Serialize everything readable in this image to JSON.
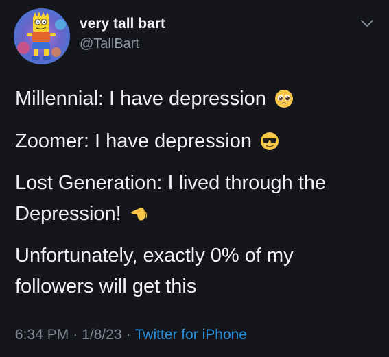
{
  "author": {
    "display_name": "very tall bart",
    "handle": "@TallBart"
  },
  "tweet": {
    "lines": [
      {
        "text": "Millennial: I have depression",
        "emoji": "pleading-face-icon"
      },
      {
        "text": "Zoomer: I have depression",
        "emoji": "sunglasses-face-icon"
      },
      {
        "text": "Lost Generation: I lived through the",
        "emoji": ""
      },
      {
        "text": "Depression!",
        "emoji": "saluting-hand-icon"
      },
      {
        "text": "Unfortunately, exactly 0% of my",
        "emoji": ""
      },
      {
        "text": "followers will get this",
        "emoji": ""
      }
    ]
  },
  "meta": {
    "time": "6:34 PM",
    "separator": "·",
    "date": "1/8/23",
    "source": "Twitter for iPhone"
  },
  "colors": {
    "background": "#14161b",
    "text": "#f0f1f2",
    "muted": "#7d8791",
    "link": "#2c8fd8"
  }
}
